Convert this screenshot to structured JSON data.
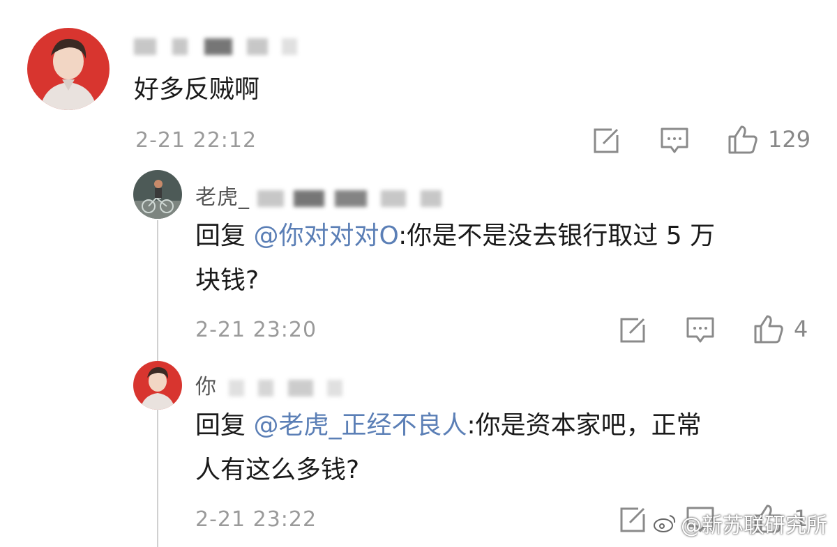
{
  "comments": [
    {
      "username_partial": "",
      "text": "好多反贼啊",
      "time": "2-21 22:12",
      "likes": "129"
    },
    {
      "username_partial": "老虎_",
      "reply_prefix": "回复 ",
      "mention": "@你对对对O",
      "text_line1": ":你是不是没去银行取过 5 万",
      "text_line2": "块钱?",
      "time": "2-21 23:20",
      "likes": "4"
    },
    {
      "username_partial": "你",
      "reply_prefix": "回复 ",
      "mention": "@老虎_正经不良人",
      "text_line1": ":你是资本家吧，正常",
      "text_line2": "人有这么多钱?",
      "time": "2-21 23:22",
      "likes": "1"
    }
  ],
  "watermark": "@新苏联研究所",
  "icons": {
    "share": "share-edit-icon",
    "comment": "comment-icon",
    "like": "thumbs-up-icon"
  },
  "colors": {
    "mention": "#5b7fb6",
    "avatar_red": "#d8352f"
  }
}
